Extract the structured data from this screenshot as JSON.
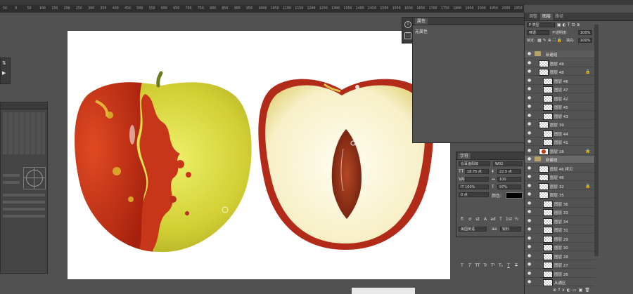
{
  "ruler": {
    "ticks": [
      "50",
      "0",
      "50",
      "100",
      "150",
      "200",
      "250",
      "300",
      "350",
      "400",
      "450",
      "500",
      "550",
      "600",
      "650",
      "700",
      "750",
      "800",
      "850",
      "900",
      "950",
      "1000",
      "1050",
      "1100",
      "1150",
      "1200",
      "1250",
      "1300",
      "1350",
      "1400",
      "1450",
      "1500",
      "1550",
      "1600",
      "1650",
      "1700",
      "1750",
      "1800",
      "1850",
      "1900",
      "1950",
      "2000",
      "2050"
    ]
  },
  "properties": {
    "tab": "属性",
    "subtitle": "无属性",
    "icons": [
      "info-icon",
      "adjust-icon"
    ]
  },
  "character": {
    "tab": "字符",
    "font_family": "仓耳渔阳体",
    "font_style": "W02",
    "size_icon": "TT",
    "size": "18.75 点",
    "leading": "22.5 点",
    "tracking": "100",
    "vscale_icon": "IT",
    "vscale": "100%",
    "hscale": "97%",
    "baseline": "0 点",
    "color_label": "颜色:",
    "kerning_label": "VA",
    "t_buttons": [
      "T",
      "T",
      "TT",
      "Tr",
      "T¹",
      "T₁",
      "T",
      "T"
    ],
    "extra_buttons": [
      "fi",
      "σ",
      "st",
      "A",
      "ad",
      "T",
      "1st",
      "½"
    ],
    "language": "美国英语",
    "aa_label": "aa",
    "aa_value": "锐利"
  },
  "layers": {
    "tabs": [
      "调整",
      "图层",
      "路径"
    ],
    "active_tab": "图层",
    "kind_filter": "P 类型",
    "blend_mode": "穿透",
    "opacity_label": "不透明度:",
    "opacity": "100%",
    "lock_label": "锁定:",
    "fill_label": "填充:",
    "fill": "100%",
    "rows": [
      {
        "name": "新建组",
        "type": "group",
        "indent": 0
      },
      {
        "name": "图层 48",
        "type": "layer",
        "indent": 1
      },
      {
        "name": "图层 48",
        "type": "layer",
        "indent": 1,
        "lock": true
      },
      {
        "name": "图层 46",
        "type": "layer",
        "indent": 2
      },
      {
        "name": "图层 47",
        "type": "layer",
        "indent": 2
      },
      {
        "name": "图层 42",
        "type": "layer",
        "indent": 2
      },
      {
        "name": "图层 45",
        "type": "layer",
        "indent": 2
      },
      {
        "name": "图层 43",
        "type": "layer",
        "indent": 2
      },
      {
        "name": "图层 39",
        "type": "layer",
        "indent": 1
      },
      {
        "name": "图层 44",
        "type": "layer",
        "indent": 2
      },
      {
        "name": "图层 41",
        "type": "layer",
        "indent": 2
      },
      {
        "name": "图层 28",
        "type": "layer",
        "indent": 1,
        "lock": true,
        "red": true
      },
      {
        "name": "新建组",
        "type": "group",
        "indent": 0,
        "selected": true
      },
      {
        "name": "图层 46 拷贝",
        "type": "layer",
        "indent": 1
      },
      {
        "name": "图层 46",
        "type": "layer",
        "indent": 1
      },
      {
        "name": "图层 32",
        "type": "layer",
        "indent": 1,
        "lock": true
      },
      {
        "name": "图层 35",
        "type": "layer",
        "indent": 1
      },
      {
        "name": "图层 36",
        "type": "layer",
        "indent": 2
      },
      {
        "name": "图层 33",
        "type": "layer",
        "indent": 2
      },
      {
        "name": "图层 34",
        "type": "layer",
        "indent": 2
      },
      {
        "name": "图层 31",
        "type": "layer",
        "indent": 2
      },
      {
        "name": "图层 29",
        "type": "layer",
        "indent": 2
      },
      {
        "name": "图层 30",
        "type": "layer",
        "indent": 2
      },
      {
        "name": "图层 28",
        "type": "layer",
        "indent": 2
      },
      {
        "name": "图层 27",
        "type": "layer",
        "indent": 2
      },
      {
        "name": "图层 26",
        "type": "layer",
        "indent": 2
      },
      {
        "name": "从通区",
        "type": "layer",
        "indent": 2
      }
    ]
  },
  "colors": {
    "panel": "#535353",
    "header": "#3c3c3c",
    "apple_red": "#c83a1c",
    "apple_yellow": "#d9d43a",
    "flesh": "#fbf6dc",
    "seed": "#8b2a14"
  }
}
